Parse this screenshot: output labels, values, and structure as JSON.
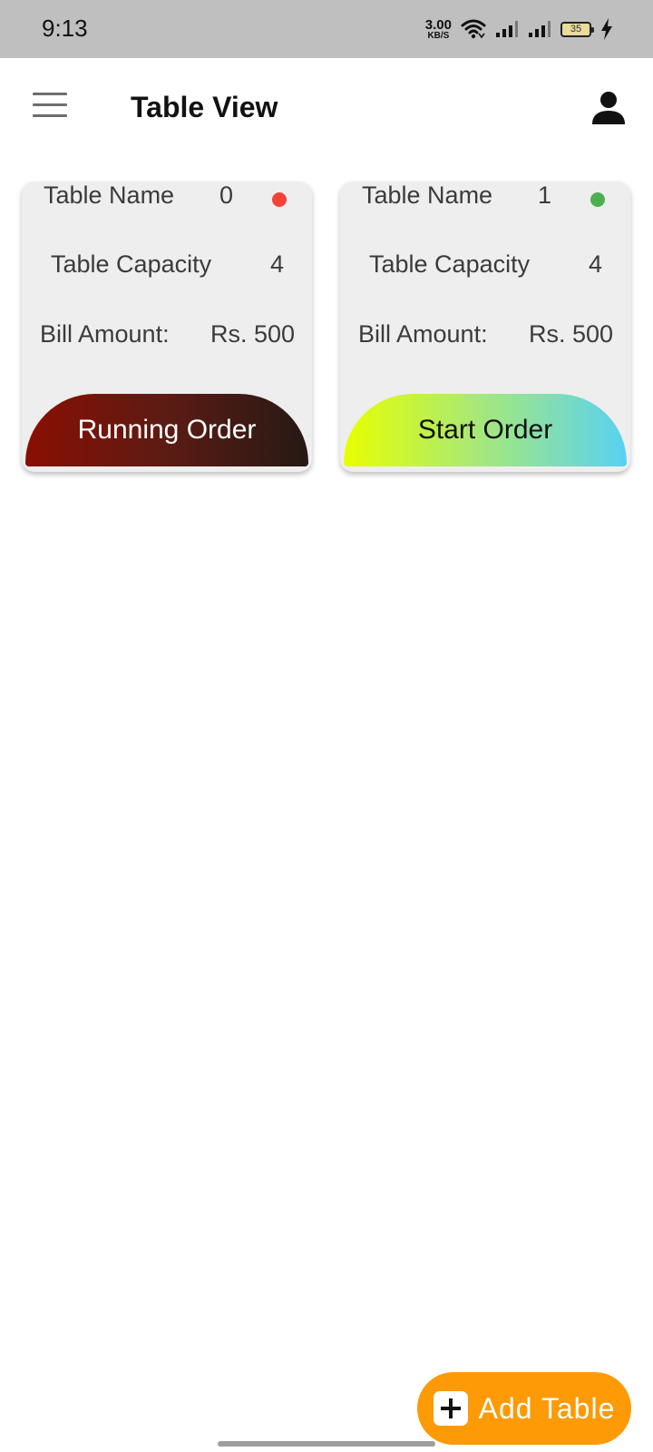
{
  "status_bar": {
    "time": "9:13",
    "net_speed_value": "3.00",
    "net_speed_unit": "KB/S",
    "battery_level": "35",
    "icons": [
      "wifi-icon",
      "signal-icon",
      "signal-icon",
      "battery-icon",
      "charging-icon"
    ]
  },
  "app_bar": {
    "title": "Table View",
    "menu_icon": "hamburger-menu-icon",
    "profile_icon": "person-icon"
  },
  "tables": [
    {
      "name_label": "Table Name",
      "name_value": "0",
      "status_color": "#f44336",
      "capacity_label": "Table Capacity",
      "capacity_value": "4",
      "bill_label": "Bill Amount:",
      "bill_value": "Rs. 500",
      "button_label": "Running Order"
    },
    {
      "name_label": "Table Name",
      "name_value": "1",
      "status_color": "#4caf50",
      "capacity_label": "Table Capacity",
      "capacity_value": "4",
      "bill_label": "Bill Amount:",
      "bill_value": "Rs. 500",
      "button_label": "Start Order"
    }
  ],
  "fab": {
    "label": "Add Table",
    "icon": "plus-icon",
    "color": "#fd9a05"
  }
}
